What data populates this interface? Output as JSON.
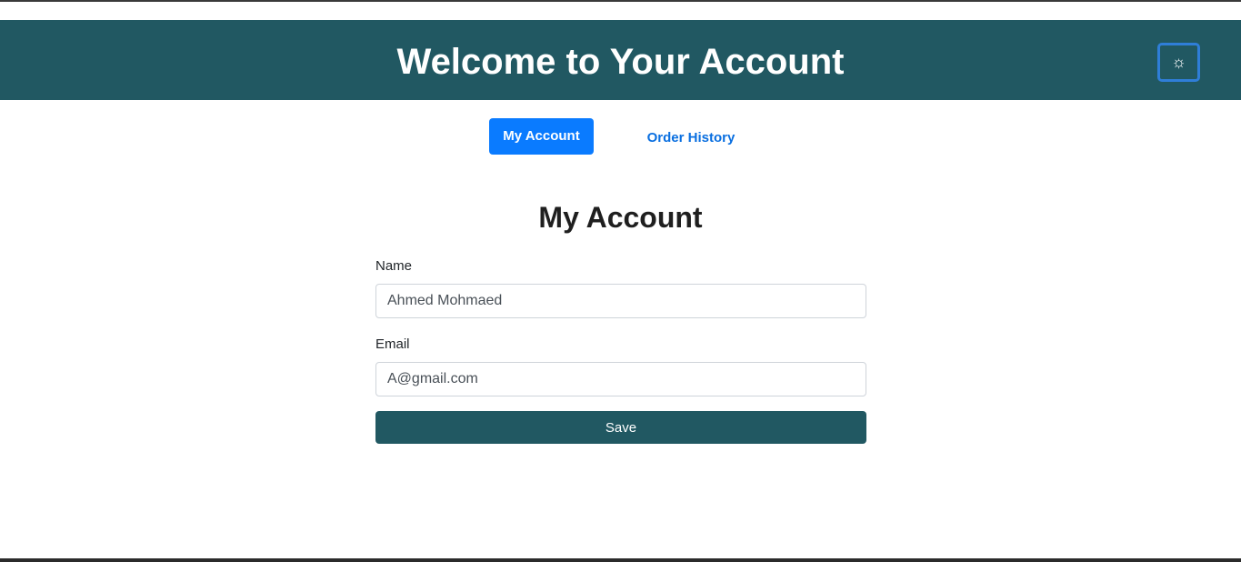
{
  "header": {
    "title": "Welcome to Your Account",
    "theme_toggle_icon": "☼"
  },
  "tabs": [
    {
      "label": "My Account",
      "active": true
    },
    {
      "label": "Order History",
      "active": false
    }
  ],
  "account": {
    "title": "My Account",
    "name_label": "Name",
    "name_value": "Ahmed Mohmaed",
    "email_label": "Email",
    "email_value": "A@gmail.com",
    "save_label": "Save"
  },
  "colors": {
    "header_bg": "#215862",
    "active_tab": "#0a7bff",
    "link": "#0a6fe0",
    "focus_ring": "#2f7ed8"
  }
}
